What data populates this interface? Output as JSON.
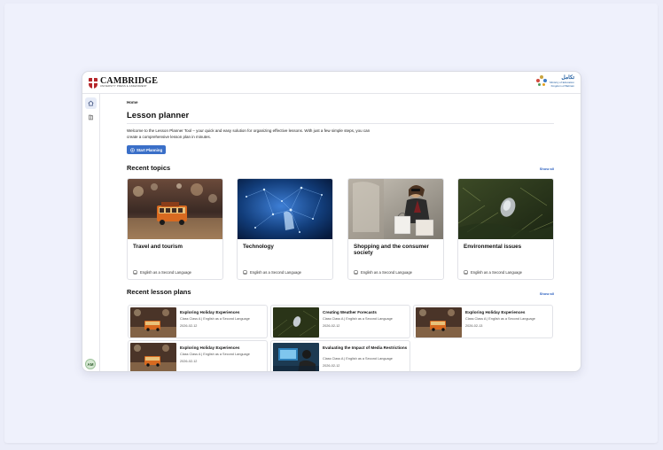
{
  "header": {
    "logo_main": "CAMBRIDGE",
    "logo_sub": "UNIVERSITY PRESS & ASSESSMENT",
    "partner_arabic": "تكامل",
    "partner_line1": "Ministry of Education",
    "partner_line2": "Kingdom of Bahrain"
  },
  "sidebar": {
    "avatar_initials": "AM"
  },
  "breadcrumb": "Home",
  "page_title": "Lesson planner",
  "intro": "Welcome to the Lesson Planner Tool – your quick and easy solution for organizing effective lessons. With just a few simple steps, you can create a comprehensive lesson plan in minutes.",
  "start_button": "Start Planning",
  "recent_topics": {
    "title": "Recent topics",
    "show_all": "Show all",
    "items": [
      {
        "title": "Travel and tourism",
        "subject": "English as a Second Language"
      },
      {
        "title": "Technology",
        "subject": "English as a Second Language"
      },
      {
        "title": "Shopping and the consumer society",
        "subject": "English as a Second Language"
      },
      {
        "title": "Environmental issues",
        "subject": "English as a Second Language"
      }
    ]
  },
  "recent_plans": {
    "title": "Recent lesson plans",
    "show_all": "Show all",
    "items": [
      {
        "title": "Exploring Holiday Experiences",
        "meta": "Class Class A | English as a Second Language",
        "date": "2026-02-12"
      },
      {
        "title": "Creating Weather Forecasts",
        "meta": "Class Class A | English as a Second Language",
        "date": "2026-02-12"
      },
      {
        "title": "Exploring Holiday Experiences",
        "meta": "Class Class A | English as a Second Language",
        "date": "2026-02-13"
      },
      {
        "title": "Exploring Holiday Experiences",
        "meta": "Class Class A | English as a Second Language",
        "date": "2026-02-12"
      },
      {
        "title": "Evaluating the Impact of Media Restrictions",
        "meta": "Class Class A | English as a Second Language",
        "date": "2026-02-12"
      }
    ]
  },
  "icons": {
    "home": "home-icon",
    "library": "book-icon",
    "start": "plus-circle-icon",
    "subject": "book-icon"
  },
  "colors": {
    "accent": "#3a6fc8",
    "link": "#2f63c0",
    "brand_red": "#b5262a"
  }
}
